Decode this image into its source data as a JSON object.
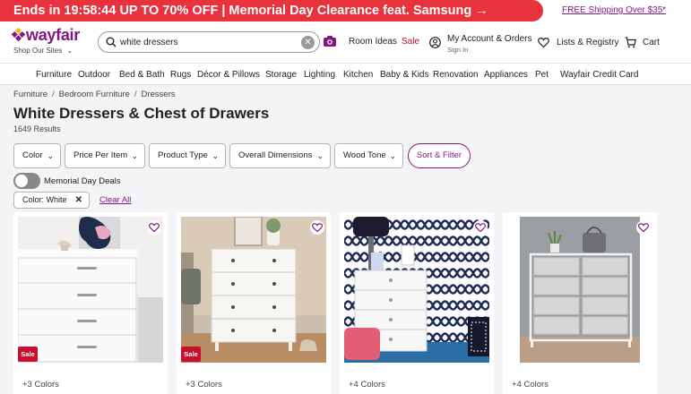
{
  "promo": {
    "text": "Ends in 19:58:44  UP TO 70% OFF | Memorial Day Clearance feat. Samsung →",
    "free_shipping": "FREE Shipping Over $35*"
  },
  "header": {
    "logo": "wayfair",
    "shop_sites": "Shop Our Sites",
    "search_value": "white dressers",
    "room_ideas": "Room Ideas",
    "sale": "Sale",
    "account": "My Account & Orders",
    "sign_in": "Sign In",
    "lists": "Lists & Registry",
    "cart": "Cart"
  },
  "nav": [
    "Furniture",
    "Outdoor",
    "Bed & Bath",
    "Rugs",
    "Décor & Pillows",
    "Storage",
    "Lighting",
    "Kitchen",
    "Baby & Kids",
    "Renovation",
    "Appliances",
    "Pet",
    "Wayfair Credit Card"
  ],
  "breadcrumbs": [
    "Furniture",
    "Bedroom Furniture",
    "Dressers"
  ],
  "page": {
    "title": "White Dressers & Chest of Drawers",
    "result_count": "1649 Results"
  },
  "filters": [
    "Color",
    "Price Per Item",
    "Product Type",
    "Overall Dimensions",
    "Wood Tone"
  ],
  "sort_filter": "Sort & Filter",
  "toggle_label": "Memorial Day Deals",
  "chip_label": "Color: White",
  "clear_all": "Clear All",
  "products": [
    {
      "colors": "+3 Colors",
      "sale": "Sale"
    },
    {
      "colors": "+3 Colors",
      "sale": "Sale"
    },
    {
      "colors": "+4 Colors"
    },
    {
      "colors": "+4 Colors"
    }
  ],
  "colors": {
    "promo_red": "#e8323c",
    "brand_purple": "#7f187f",
    "sale_red": "#c8102e"
  }
}
